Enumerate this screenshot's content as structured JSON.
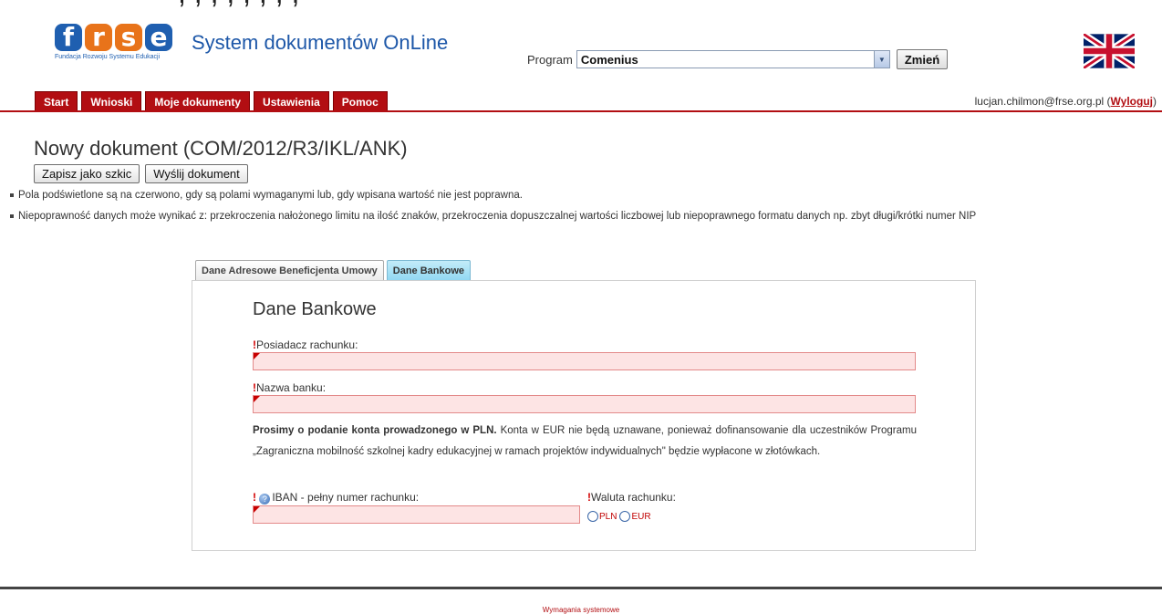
{
  "header": {
    "app_title": "System dokumentów OnLine",
    "logo_text": "frse",
    "logo_caption": "Fundacja Rozwoju Systemu Edukacji",
    "program_label": "Program",
    "program_value": "Comenius",
    "change_button": "Zmień",
    "flag_icon": "uk-flag-icon"
  },
  "nav": {
    "tabs": [
      "Start",
      "Wnioski",
      "Moje dokumenty",
      "Ustawienia",
      "Pomoc"
    ],
    "user_email": "lucjan.chilmon@frse.org.pl",
    "logout_open": "(",
    "logout_label": "Wyloguj",
    "logout_close": ")",
    "tab_color": "#b20e12"
  },
  "page": {
    "title": "Nowy dokument (COM/2012/R3/IKL/ANK)",
    "save_draft_button": "Zapisz jako szkic",
    "send_button": "Wyślij dokument",
    "notes": [
      "Pola podświetlone są na czerwono, gdy są polami wymaganymi lub, gdy wpisana wartość nie jest poprawna.",
      "Niepoprawność danych może wynikać z: przekroczenia nałożonego limitu na ilość znaków, przekroczenia dopuszczalnej wartości liczbowej lub niepoprawnego formatu danych np. zbyt długi/krótki numer NIP"
    ]
  },
  "doc_tabs": [
    "Dane Adresowe Beneficjenta Umowy",
    "Dane Bankowe"
  ],
  "form": {
    "section_title": "Dane Bankowe",
    "required_mark": "!",
    "account_holder_label": "Posiadacz rachunku:",
    "bank_name_label": "Nazwa banku:",
    "info_bold": "Prosimy o podanie konta prowadzonego w PLN.",
    "info_rest": " Konta w EUR nie będą uznawane, ponieważ dofinansowanie dla uczestników Programu „Zagraniczna mobilność szkolnej kadry edukacyjnej w ramach projektów indywidualnych\" będzie wypłacone w złotówkach.",
    "iban_label": "IBAN - pełny numer rachunku:",
    "currency_label": "Waluta rachunku:",
    "currency_options": [
      "PLN",
      "EUR"
    ],
    "invalid_fill": "#fde4e4"
  },
  "footer": {
    "system_requirements": "Wymagania systemowe"
  }
}
